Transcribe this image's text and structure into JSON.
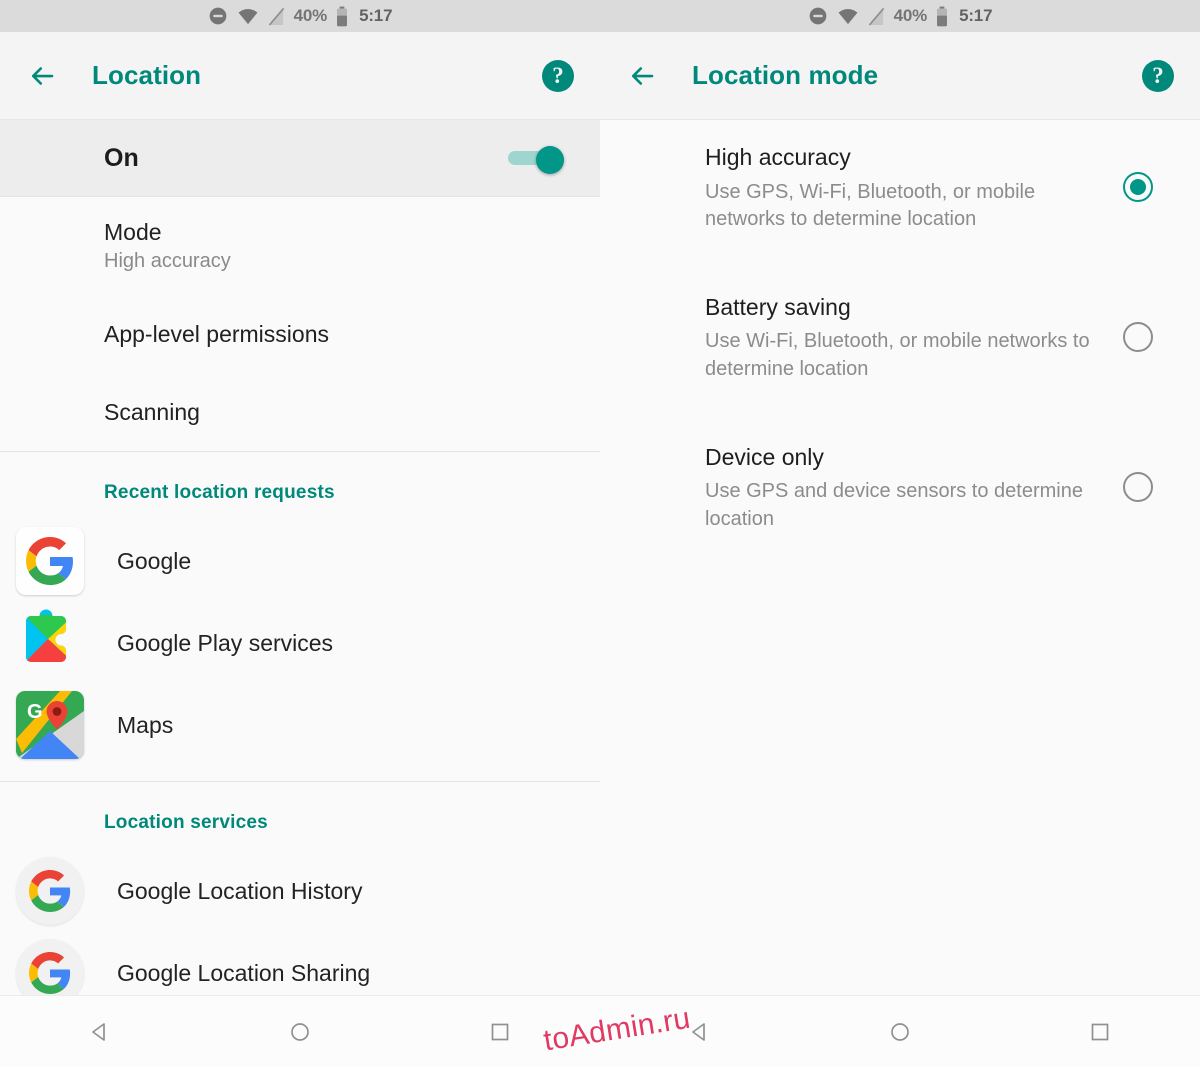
{
  "colors": {
    "accent": "#00897B",
    "toggle_on": "#009688",
    "radio_selected": "#009688",
    "statusbar_bg": "#DBDBDB",
    "appbar_bg": "#F4F4F4",
    "panel_bg": "#FAFAFA",
    "highlight_row_bg": "#EDEDED",
    "watermark": "#E03A63"
  },
  "statusbar": {
    "icons": [
      "do-not-disturb-icon",
      "wifi-icon",
      "no-sim-signal-icon",
      "battery-icon"
    ],
    "battery_percent": "40%",
    "time": "5:17"
  },
  "left_panel": {
    "appbar": {
      "back_icon": "arrow-left-icon",
      "title": "Location",
      "help_icon": "help-circle-icon",
      "help_label": "?"
    },
    "master_toggle": {
      "label": "On",
      "state": "on"
    },
    "settings": [
      {
        "title": "Mode",
        "sub": "High accuracy"
      },
      {
        "title": "App-level permissions",
        "sub": ""
      },
      {
        "title": "Scanning",
        "sub": ""
      }
    ],
    "recent_requests": {
      "header": "Recent location requests",
      "apps": [
        {
          "name": "Google",
          "icon": "google-g-icon"
        },
        {
          "name": "Google Play services",
          "icon": "google-play-services-icon"
        },
        {
          "name": "Maps",
          "icon": "google-maps-icon"
        }
      ]
    },
    "location_services": {
      "header": "Location services",
      "items": [
        {
          "name": "Google Location History",
          "icon": "google-g-icon"
        },
        {
          "name": "Google Location Sharing",
          "icon": "google-g-icon"
        }
      ]
    }
  },
  "right_panel": {
    "appbar": {
      "back_icon": "arrow-left-icon",
      "title": "Location mode",
      "help_icon": "help-circle-icon",
      "help_label": "?"
    },
    "options": [
      {
        "title": "High accuracy",
        "desc": "Use GPS, Wi-Fi, Bluetooth, or mobile networks to determine location",
        "selected": true
      },
      {
        "title": "Battery saving",
        "desc": "Use Wi-Fi, Bluetooth, or mobile networks to determine location",
        "selected": false
      },
      {
        "title": "Device only",
        "desc": "Use GPS and device sensors to determine location",
        "selected": false
      }
    ]
  },
  "navbar": {
    "buttons": [
      {
        "icon": "back-triangle-icon"
      },
      {
        "icon": "home-circle-icon"
      },
      {
        "icon": "recents-square-icon"
      }
    ]
  },
  "watermark": {
    "text": "toAdmin.ru"
  }
}
